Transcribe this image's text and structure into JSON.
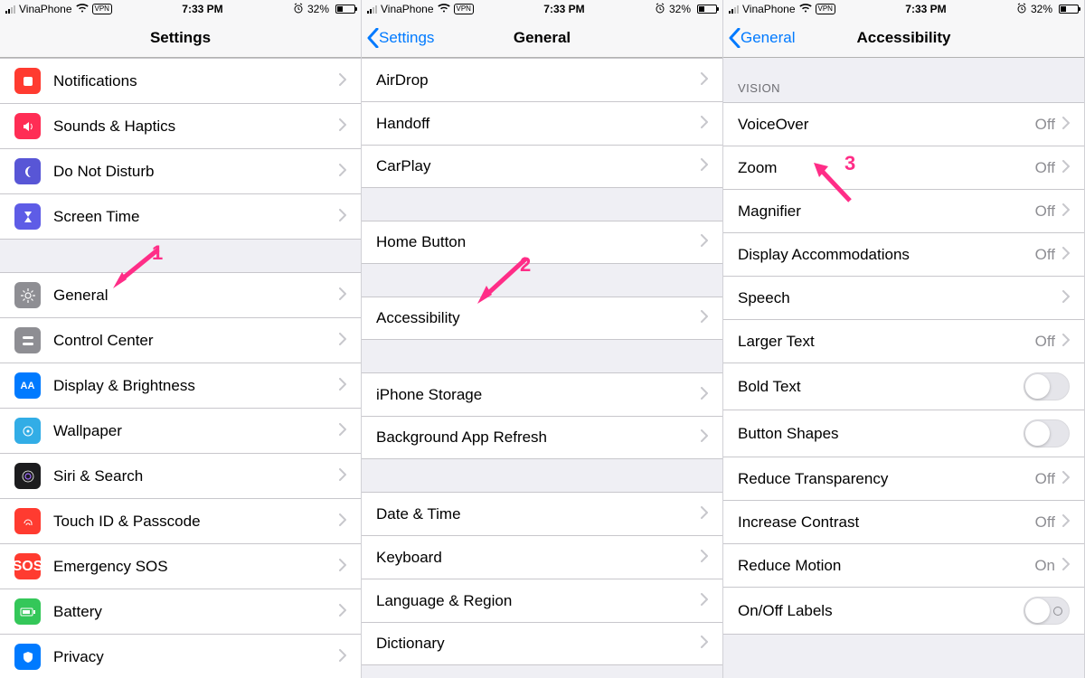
{
  "status": {
    "carrier": "VinaPhone",
    "vpn": "VPN",
    "time": "7:33 PM",
    "battery_pct": "32%"
  },
  "screen1": {
    "title": "Settings",
    "rows_g1": [
      {
        "label": "Notifications"
      },
      {
        "label": "Sounds & Haptics"
      },
      {
        "label": "Do Not Disturb"
      },
      {
        "label": "Screen Time"
      }
    ],
    "rows_g2": [
      {
        "label": "General"
      },
      {
        "label": "Control Center"
      },
      {
        "label": "Display & Brightness"
      },
      {
        "label": "Wallpaper"
      },
      {
        "label": "Siri & Search"
      },
      {
        "label": "Touch ID & Passcode"
      },
      {
        "label": "Emergency SOS"
      },
      {
        "label": "Battery"
      },
      {
        "label": "Privacy"
      }
    ],
    "anno_num": "1"
  },
  "screen2": {
    "back": "Settings",
    "title": "General",
    "g1": [
      {
        "label": "AirDrop"
      },
      {
        "label": "Handoff"
      },
      {
        "label": "CarPlay"
      }
    ],
    "g2": [
      {
        "label": "Home Button"
      }
    ],
    "g3": [
      {
        "label": "Accessibility"
      }
    ],
    "g4": [
      {
        "label": "iPhone Storage"
      },
      {
        "label": "Background App Refresh"
      }
    ],
    "g5": [
      {
        "label": "Date & Time"
      },
      {
        "label": "Keyboard"
      },
      {
        "label": "Language & Region"
      },
      {
        "label": "Dictionary"
      }
    ],
    "anno_num": "2"
  },
  "screen3": {
    "back": "General",
    "title": "Accessibility",
    "section_header": "VISION",
    "rows": [
      {
        "label": "VoiceOver",
        "value": "Off",
        "chev": true
      },
      {
        "label": "Zoom",
        "value": "Off",
        "chev": true
      },
      {
        "label": "Magnifier",
        "value": "Off",
        "chev": true
      },
      {
        "label": "Display Accommodations",
        "value": "Off",
        "chev": true
      },
      {
        "label": "Speech",
        "value": "",
        "chev": true
      },
      {
        "label": "Larger Text",
        "value": "Off",
        "chev": true
      },
      {
        "label": "Bold Text",
        "toggle": true
      },
      {
        "label": "Button Shapes",
        "toggle": true
      },
      {
        "label": "Reduce Transparency",
        "value": "Off",
        "chev": true
      },
      {
        "label": "Increase Contrast",
        "value": "Off",
        "chev": true
      },
      {
        "label": "Reduce Motion",
        "value": "On",
        "chev": true
      },
      {
        "label": "On/Off Labels",
        "toggle": true,
        "labeled": true
      }
    ],
    "anno_num": "3"
  }
}
